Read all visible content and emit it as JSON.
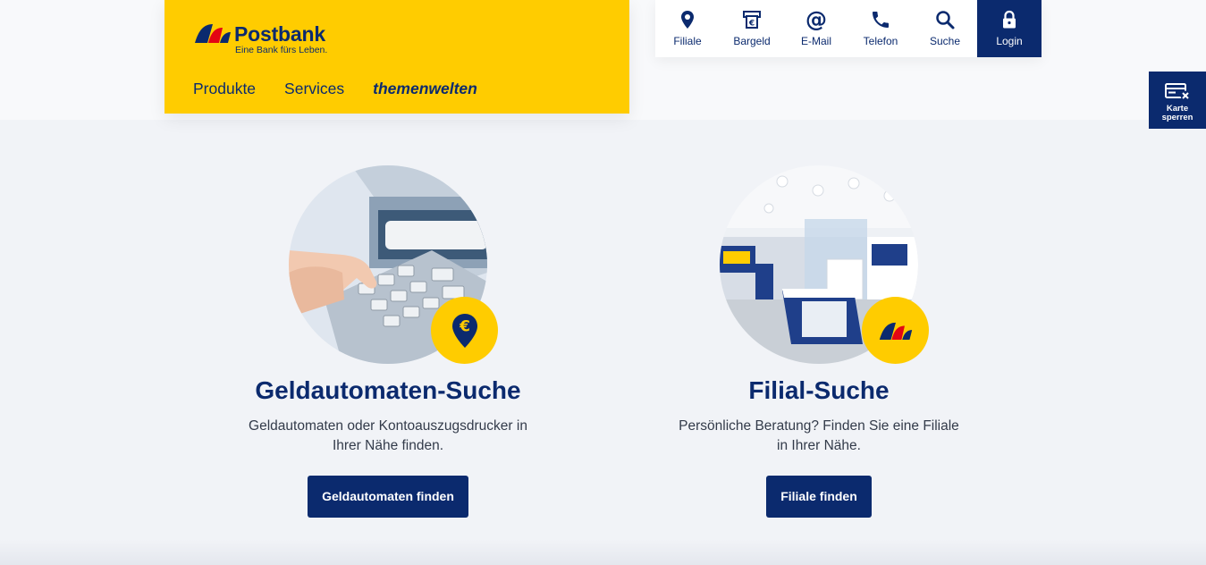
{
  "brand": {
    "name": "Postbank",
    "tagline": "Eine Bank fürs Leben."
  },
  "main_nav": {
    "items": [
      "Produkte",
      "Services"
    ],
    "themen_bold": "themen",
    "themen_rest": "welten"
  },
  "util_nav": {
    "filiale": "Filiale",
    "bargeld": "Bargeld",
    "email": "E-Mail",
    "telefon": "Telefon",
    "suche": "Suche",
    "login": "Login"
  },
  "karte_sperren": {
    "line1": "Karte",
    "line2": "sperren"
  },
  "cards": {
    "atm": {
      "title": "Geldautomaten-Suche",
      "text_line1": "Geldautomaten oder Kontoauszugsdrucker in",
      "text_line2": "Ihrer Nähe finden.",
      "button": "Geldautomaten finden"
    },
    "branch": {
      "title": "Filial-Suche",
      "text_line1": "Persönliche Beratung? Finden Sie eine Filiale",
      "text_line2": "in Ihrer Nähe.",
      "button": "Filiale finden"
    }
  },
  "colors": {
    "brand_yellow": "#ffcc00",
    "brand_navy": "#0b2a6e",
    "page_bg": "#f1f3f7"
  },
  "icons": {
    "filiale": "map-pin-icon",
    "bargeld": "cash-icon",
    "email": "at-sign-icon",
    "telefon": "phone-icon",
    "suche": "search-icon",
    "login": "lock-icon",
    "karte_sperren": "card-block-icon",
    "atm_badge": "euro-pin-icon",
    "branch_badge": "postbank-logo-icon"
  }
}
